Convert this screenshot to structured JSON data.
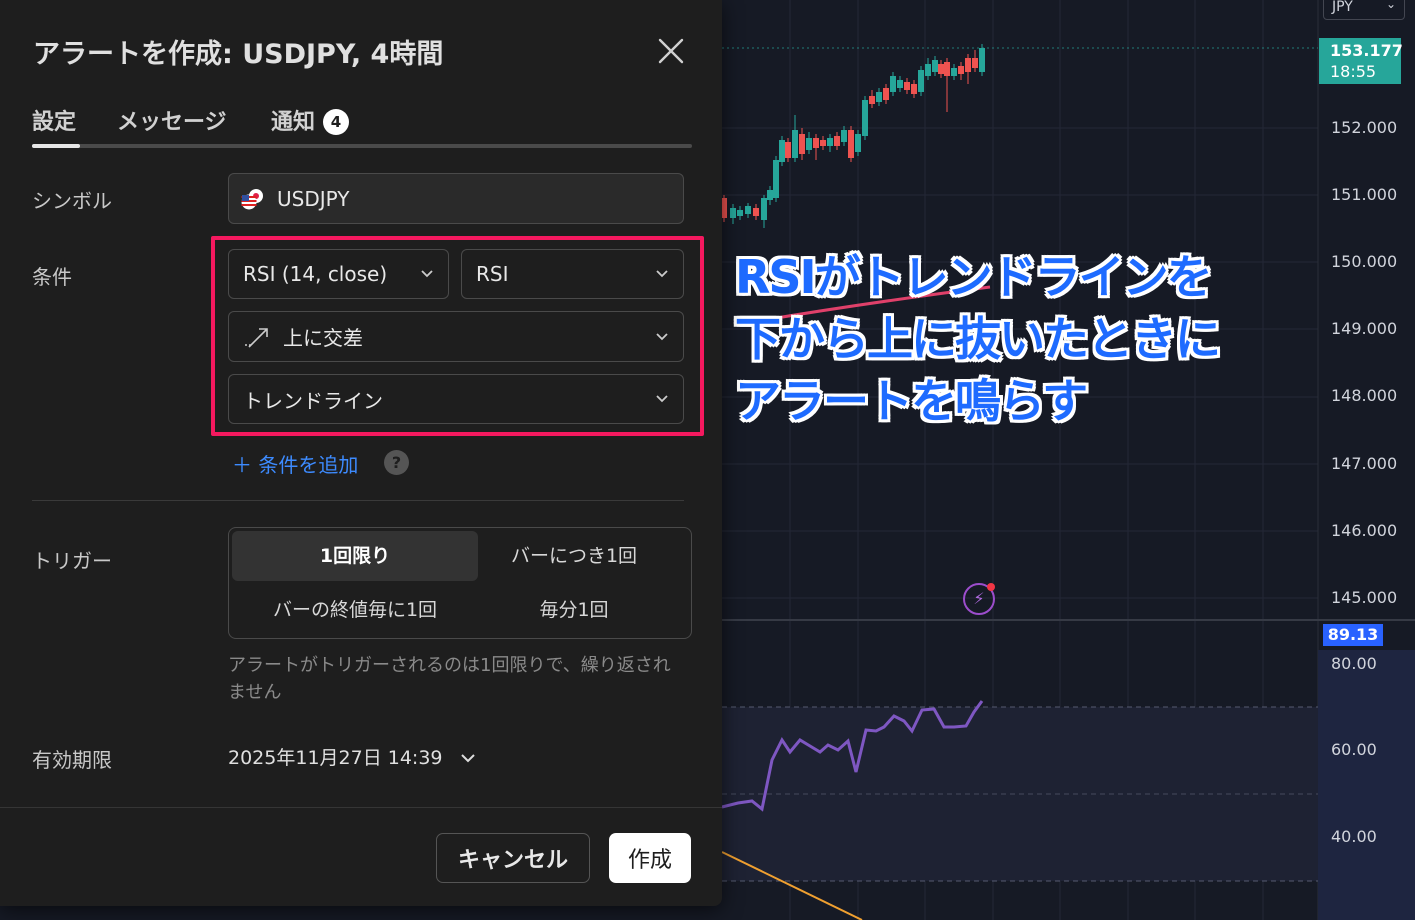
{
  "dialog": {
    "title": "アラートを作成: USDJPY, 4時間",
    "tabs": [
      {
        "label": "設定"
      },
      {
        "label": "メッセージ"
      },
      {
        "label": "通知",
        "badge": "4"
      }
    ],
    "symbol_label": "シンボル",
    "symbol_value": "USDJPY",
    "condition_label": "条件",
    "condition": {
      "indicator": "RSI (14, close)",
      "plot": "RSI",
      "operator": "上に交差",
      "target": "トレンドライン"
    },
    "add_condition": "＋ 条件を追加",
    "help": "?",
    "trigger_label": "トリガー",
    "trigger_options": [
      "1回限り",
      "バーにつき1回",
      "バーの終値毎に1回",
      "毎分1回"
    ],
    "trigger_selected": "1回限り",
    "trigger_hint": "アラートがトリガーされるのは1回限りで、繰り返されません",
    "expiry_label": "有効期限",
    "expiry_value": "2025年11月27日 14:39",
    "cancel_label": "キャンセル",
    "create_label": "作成"
  },
  "chart": {
    "currency": "JPY",
    "last_price": "153.177",
    "countdown": "18:55",
    "price_ticks": [
      "152.000",
      "151.000",
      "150.000",
      "149.000",
      "148.000",
      "147.000",
      "146.000",
      "145.000"
    ],
    "rsi_value": "89.13",
    "rsi_ticks": [
      "80.00",
      "60.00",
      "40.00"
    ],
    "annotation_lines": [
      "RSIがトレンドラインを",
      "下から上に抜いたときに",
      "アラートを鳴らす"
    ]
  },
  "colors": {
    "up": "#26a69a",
    "down": "#ef5350",
    "rsi_line": "#7e57c2",
    "highlight": "#f5195f",
    "accent_blue": "#3d8bff"
  }
}
